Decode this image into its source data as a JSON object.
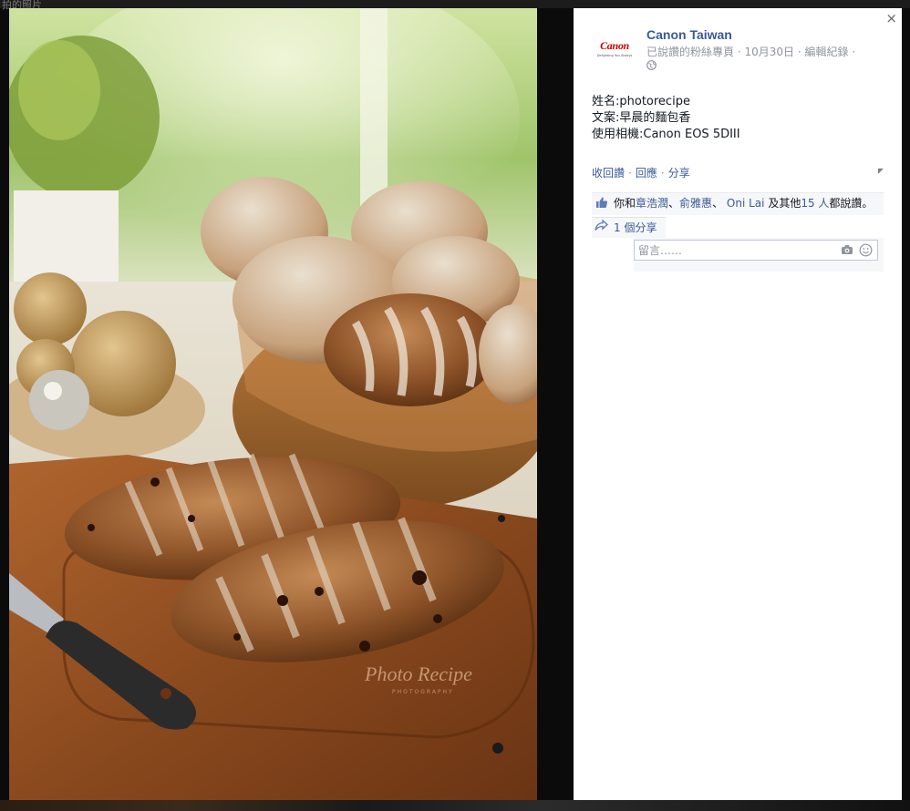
{
  "background": {
    "top_text": "拍的照片"
  },
  "photo": {
    "watermark_title": "Photo Recipe",
    "watermark_sub": "PHOTOGRAPHY"
  },
  "panel": {
    "close_label": "×",
    "avatar": {
      "brand": "Canon",
      "tagline": "Delighting You Always"
    },
    "page_name": "Canon Taiwan",
    "liked_label": "已說讚的粉絲專頁",
    "date": "10月30日",
    "edit_history": "編輯紀錄",
    "caption_lines": [
      "姓名:photorecipe",
      "文案:早晨的麵包香",
      "使用相機:Canon EOS 5DIII"
    ],
    "actions": {
      "unlike": "收回讚",
      "reply": "回應",
      "share": "分享",
      "separator": "·"
    },
    "likes": {
      "prefix": "你和",
      "friend1": "章浩潤",
      "sep": "、",
      "friend2": "俞雅惠",
      "friend3": "Oni Lai",
      "and_others": "及其他",
      "count": "15 人",
      "suffix": "都說讚。"
    },
    "shares": {
      "label": "1 個分享"
    },
    "comment": {
      "placeholder": "留言……"
    }
  },
  "colors": {
    "link": "#3b5998",
    "muted": "#90949c",
    "canon_red": "#cc0000"
  }
}
